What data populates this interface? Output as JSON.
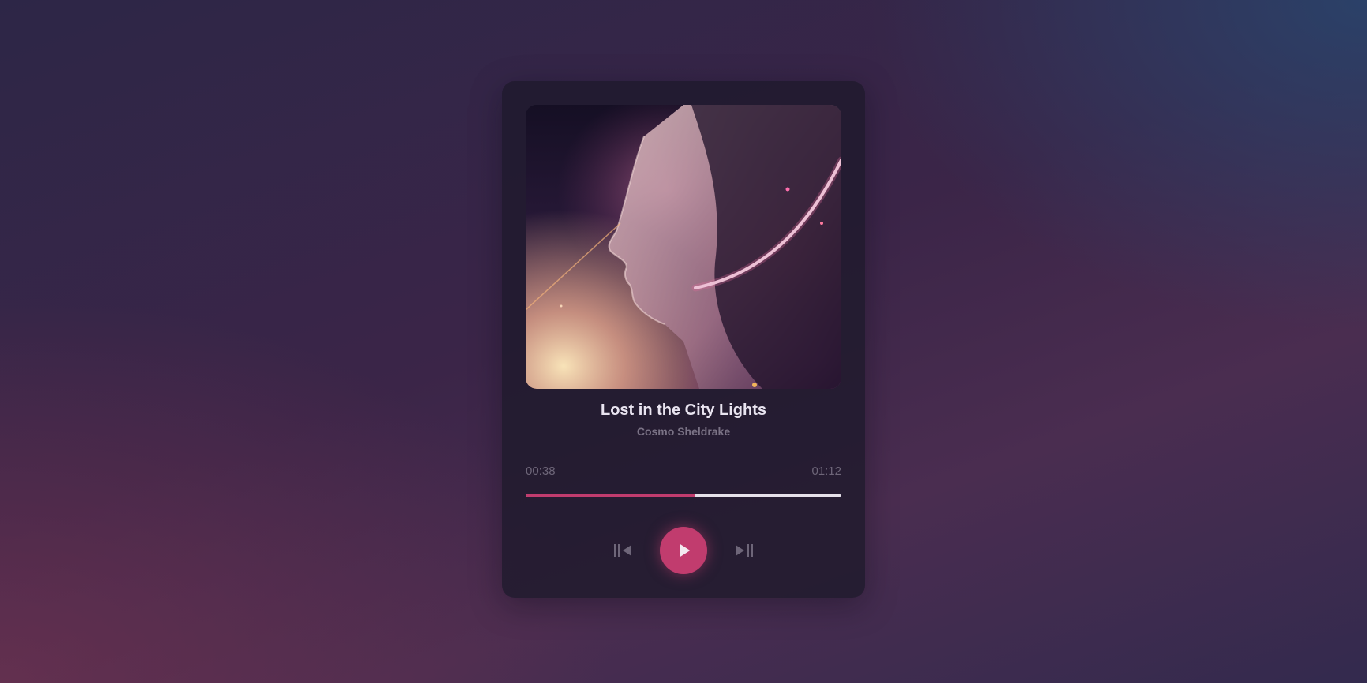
{
  "track": {
    "title": "Lost in the City Lights",
    "artist": "Cosmo Sheldrake"
  },
  "playback": {
    "current_time": "00:38",
    "total_time": "01:12",
    "progress_fraction": 0.535
  },
  "controls": {
    "prev_icon": "skip-previous-icon",
    "play_icon": "play-icon",
    "next_icon": "skip-next-icon"
  },
  "colors": {
    "accent": "#c13c6e",
    "track_bg": "#e6e1ea",
    "card_bg": "#1e1a2c"
  }
}
